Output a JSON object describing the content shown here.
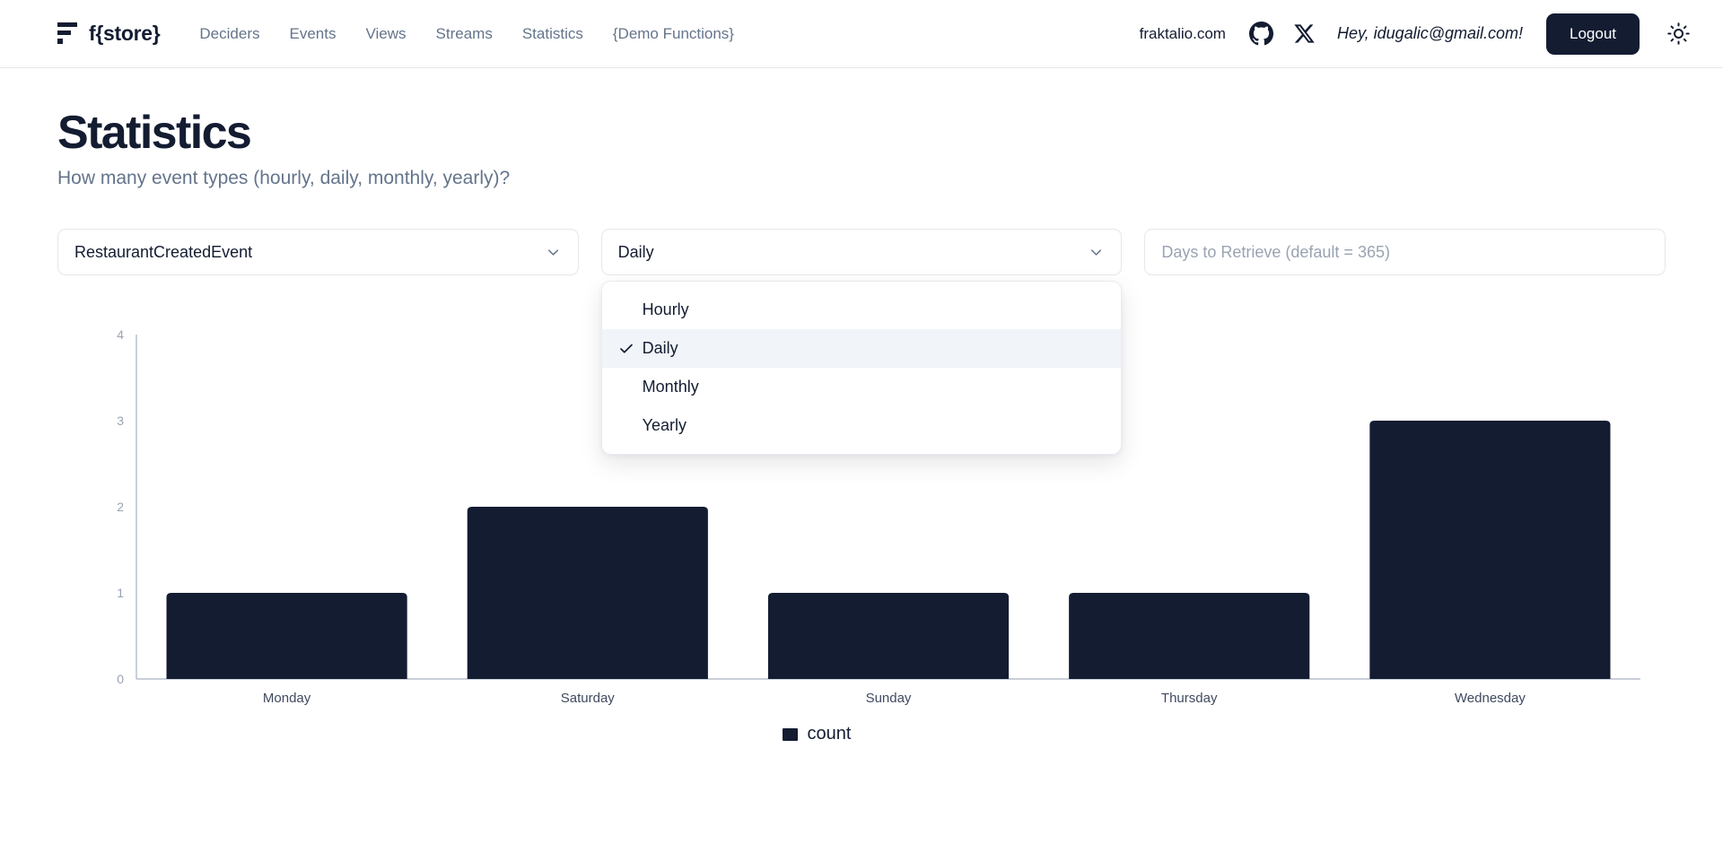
{
  "header": {
    "brand_name": "f{store}",
    "logo_icon": "fstore-logo-icon",
    "nav": [
      {
        "label": "Deciders"
      },
      {
        "label": "Events"
      },
      {
        "label": "Views"
      },
      {
        "label": "Streams"
      },
      {
        "label": "Statistics"
      },
      {
        "label": "{Demo Functions}"
      }
    ],
    "site_link": "fraktalio.com",
    "github_icon": "github-icon",
    "x_icon": "x-twitter-icon",
    "greeting": "Hey, idugalic@gmail.com!",
    "logout_label": "Logout",
    "theme_icon": "sun-icon"
  },
  "main": {
    "title": "Statistics",
    "subtitle": "How many event types (hourly, daily, monthly, yearly)?",
    "filters": {
      "event_type": {
        "value": "RestaurantCreatedEvent",
        "chevron_icon": "chevron-down-icon"
      },
      "granularity": {
        "value": "Daily",
        "chevron_icon": "chevron-down-icon",
        "open": true,
        "options": [
          {
            "label": "Hourly",
            "selected": false
          },
          {
            "label": "Daily",
            "selected": true
          },
          {
            "label": "Monthly",
            "selected": false
          },
          {
            "label": "Yearly",
            "selected": false
          }
        ],
        "check_icon": "check-icon"
      },
      "days_to_retrieve": {
        "value": "",
        "placeholder": "Days to Retrieve (default = 365)"
      }
    }
  },
  "chart_data": {
    "type": "bar",
    "title": "",
    "xlabel": "",
    "ylabel": "",
    "categories": [
      "Monday",
      "Saturday",
      "Sunday",
      "Thursday",
      "Wednesday"
    ],
    "values": [
      1,
      2,
      1,
      1,
      3
    ],
    "series": [
      {
        "name": "count",
        "values": [
          1,
          2,
          1,
          1,
          3
        ]
      }
    ],
    "ylim": [
      0,
      4
    ],
    "yticks": [
      0,
      1,
      2,
      3,
      4
    ],
    "grid": false,
    "legend": {
      "position": "bottom",
      "entries": [
        "count"
      ]
    },
    "bar_color": "#131c31"
  },
  "colors": {
    "ink": "#131c31",
    "muted": "#64748b",
    "border": "#e5e7eb",
    "accent": "#131c31",
    "axis": "#9aa3b2",
    "menu_selected_bg": "#f1f5f9"
  }
}
